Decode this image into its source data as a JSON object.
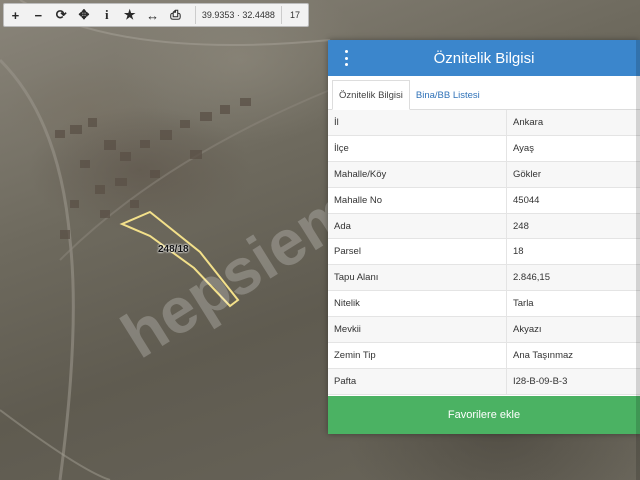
{
  "toolbar": {
    "buttons": [
      {
        "name": "zoom-in-icon",
        "glyph": "+"
      },
      {
        "name": "zoom-out-icon",
        "glyph": "−"
      },
      {
        "name": "refresh-icon",
        "glyph": "⟳"
      },
      {
        "name": "locate-icon",
        "glyph": "✥"
      },
      {
        "name": "info-icon",
        "glyph": "i"
      },
      {
        "name": "star-icon",
        "glyph": "★"
      },
      {
        "name": "measure-icon",
        "glyph": "↔"
      },
      {
        "name": "print-icon",
        "glyph": "⎙"
      }
    ],
    "coordinates": "39.9353 · 32.4488",
    "zoom": "17"
  },
  "map": {
    "parcel_label": "248/18",
    "watermark": "hepsiemlak",
    "parcel_outline_color": "#f3e08a"
  },
  "panel": {
    "title": "Öznitelik Bilgisi",
    "tabs": [
      "Öznitelik Bilgisi",
      "Bina/BB Listesi"
    ],
    "rows": [
      {
        "key": "İl",
        "value": "Ankara"
      },
      {
        "key": "İlçe",
        "value": "Ayaş"
      },
      {
        "key": "Mahalle/Köy",
        "value": "Gökler"
      },
      {
        "key": "Mahalle No",
        "value": "45044"
      },
      {
        "key": "Ada",
        "value": "248"
      },
      {
        "key": "Parsel",
        "value": "18"
      },
      {
        "key": "Tapu Alanı",
        "value": "2.846,15"
      },
      {
        "key": "Nitelik",
        "value": "Tarla"
      },
      {
        "key": "Mevkii",
        "value": "Akyazı"
      },
      {
        "key": "Zemin Tip",
        "value": "Ana Taşınmaz"
      },
      {
        "key": "Pafta",
        "value": "I28-B-09-B-3"
      }
    ],
    "favorite_button": "Favorilere ekle",
    "header_color": "#3b86cc",
    "button_color": "#4bb263"
  }
}
